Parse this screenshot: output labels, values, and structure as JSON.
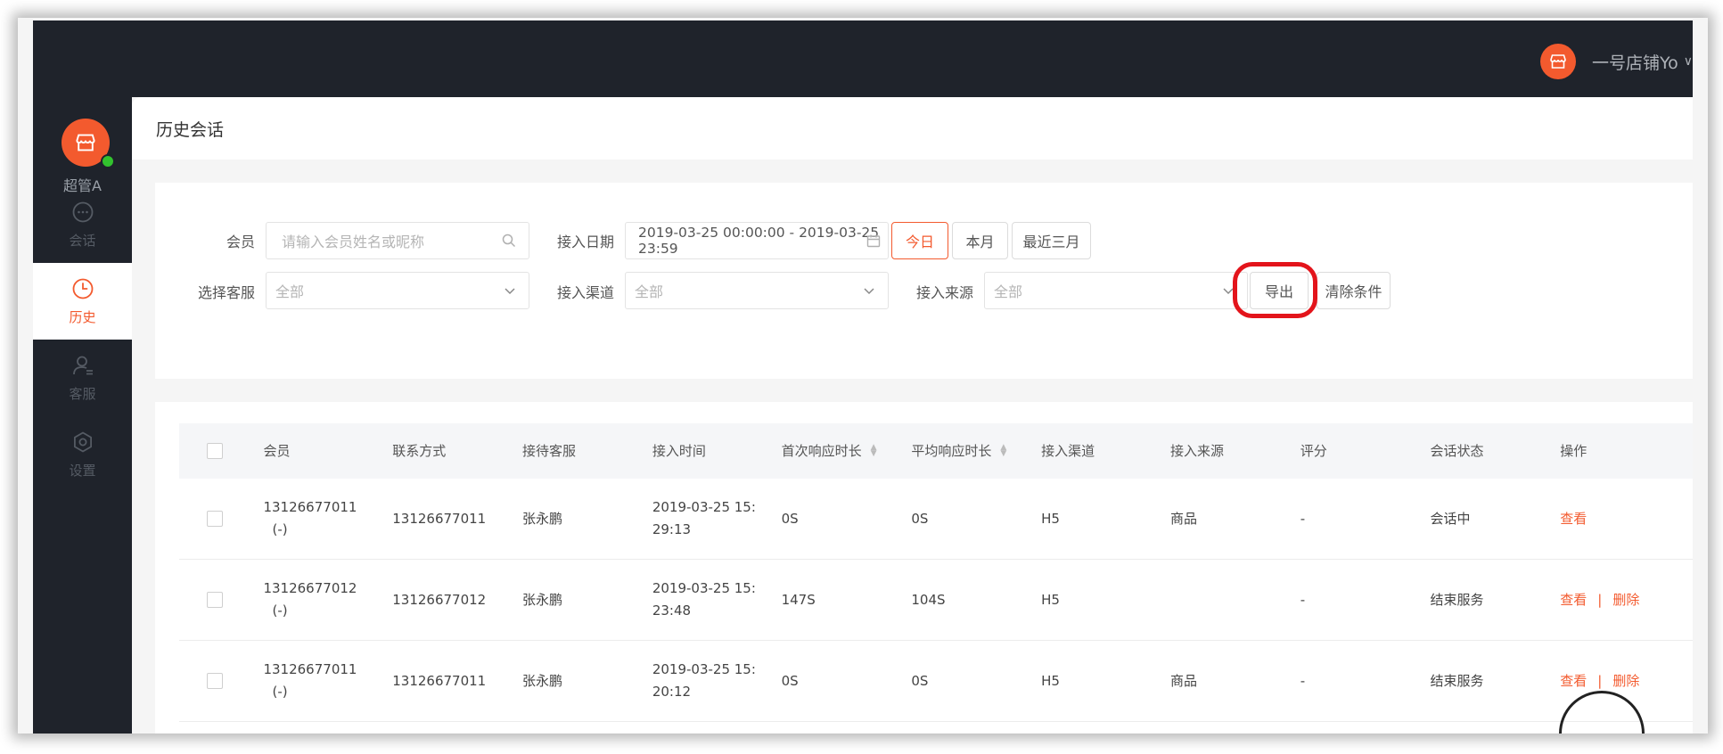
{
  "header": {
    "store_name": "一号店铺Yo"
  },
  "sidebar": {
    "user_name": "超管A",
    "items": [
      {
        "label": "会话"
      },
      {
        "label": "历史"
      },
      {
        "label": "客服"
      },
      {
        "label": "设置"
      }
    ]
  },
  "page": {
    "title": "历史会话"
  },
  "filters": {
    "member_label": "会员",
    "member_placeholder": "请输入会员姓名或昵称",
    "date_label": "接入日期",
    "date_value": "2019-03-25 00:00:00 - 2019-03-25 23:59",
    "today_btn": "今日",
    "month_btn": "本月",
    "three_month_btn": "最近三月",
    "agent_label": "选择客服",
    "agent_value": "全部",
    "channel_label": "接入渠道",
    "channel_value": "全部",
    "source_label": "接入来源",
    "source_value": "全部",
    "export_btn": "导出",
    "clear_btn": "清除条件"
  },
  "table": {
    "columns": [
      "会员",
      "联系方式",
      "接待客服",
      "接入时间",
      "首次响应时长",
      "平均响应时长",
      "接入渠道",
      "接入来源",
      "评分",
      "会话状态",
      "操作"
    ],
    "rows": [
      {
        "member": "13126677011",
        "member_sub": "(-)",
        "contact": "13126677011",
        "agent": "张永鹏",
        "time_line1": "2019-03-25 15:",
        "time_line2": "29:13",
        "first_resp": "0S",
        "avg_resp": "0S",
        "channel": "H5",
        "source": "商品",
        "score": "-",
        "status": "会话中",
        "action_view": "查看",
        "action_delete": ""
      },
      {
        "member": "13126677012",
        "member_sub": "(-)",
        "contact": "13126677012",
        "agent": "张永鹏",
        "time_line1": "2019-03-25 15:",
        "time_line2": "23:48",
        "first_resp": "147S",
        "avg_resp": "104S",
        "channel": "H5",
        "source": "",
        "score": "-",
        "status": "结束服务",
        "action_view": "查看",
        "action_delete": "删除"
      },
      {
        "member": "13126677011",
        "member_sub": "(-)",
        "contact": "13126677011",
        "agent": "张永鹏",
        "time_line1": "2019-03-25 15:",
        "time_line2": "20:12",
        "first_resp": "0S",
        "avg_resp": "0S",
        "channel": "H5",
        "source": "商品",
        "score": "-",
        "status": "结束服务",
        "action_view": "查看",
        "action_delete": "删除"
      }
    ]
  },
  "colors": {
    "accent": "#f35a2e",
    "sidebar_bg": "#1f232b",
    "online": "#32c22e",
    "highlight": "#e3141b"
  },
  "icons": [
    "store-icon",
    "chat-icon",
    "clock-icon",
    "user-service-icon",
    "settings-icon",
    "search-icon",
    "calendar-icon",
    "chevron-down-icon",
    "sort-icon"
  ]
}
